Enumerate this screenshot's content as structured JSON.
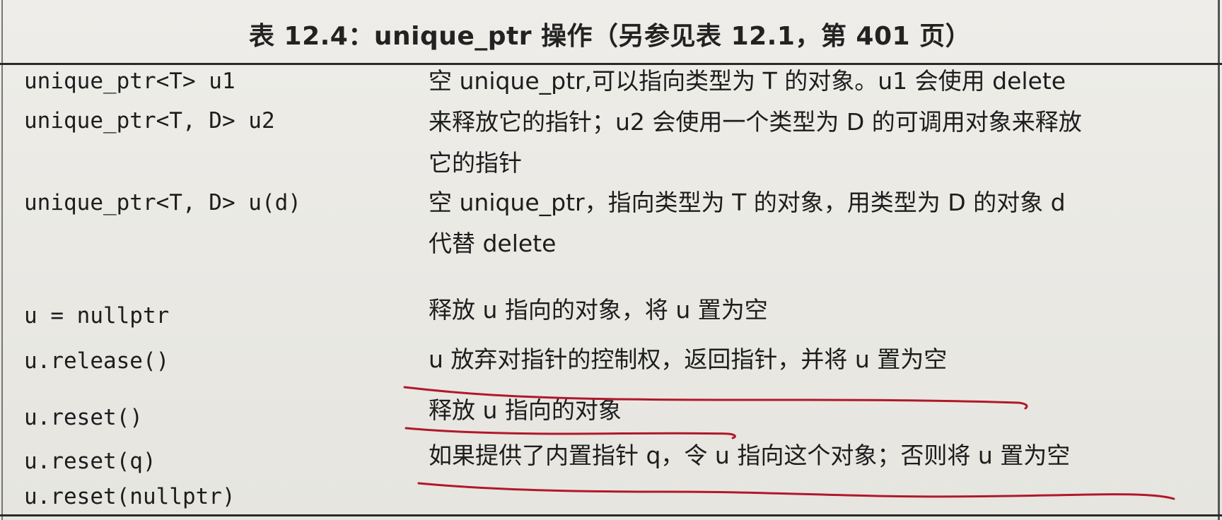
{
  "title": "表 12.4：unique_ptr 操作（另参见表 12.1，第 401 页）",
  "rows": [
    {
      "commands": [
        "unique_ptr<T> u1",
        "unique_ptr<T, D> u2"
      ],
      "description": "空 unique_ptr,可以指向类型为 T 的对象。u1 会使用 delete\n来释放它的指针；u2 会使用一个类型为 D 的可调用对象来释放\n它的指针"
    },
    {
      "commands": [
        "unique_ptr<T, D> u(d)"
      ],
      "description": "空 unique_ptr，指向类型为 T 的对象，用类型为 D 的对象 d\n代替 delete"
    },
    {
      "commands": [
        "u = nullptr"
      ],
      "description": "释放 u 指向的对象，将 u 置为空"
    },
    {
      "commands": [
        "u.release()"
      ],
      "description": "u 放弃对指针的控制权，返回指针，并将 u 置为空"
    },
    {
      "commands": [
        "u.reset()"
      ],
      "description": "释放 u 指向的对象"
    },
    {
      "commands": [
        "u.reset(q)",
        "u.reset(nullptr)"
      ],
      "description": "如果提供了内置指针 q，令 u 指向这个对象；否则将 u 置为空"
    }
  ],
  "annotation_color": "#b0182a"
}
